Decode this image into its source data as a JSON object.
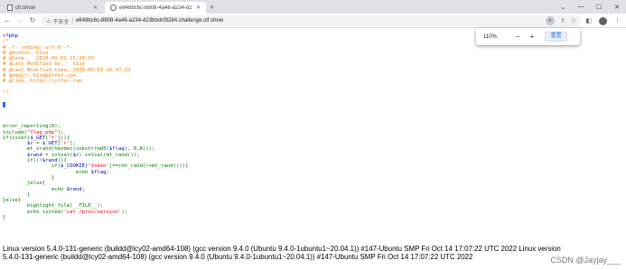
{
  "browser": {
    "tabs": [
      {
        "title": "ctf.show",
        "active": false
      },
      {
        "title": "e648bc6c-8808-4a46-a234-d2",
        "active": true
      }
    ],
    "new_tab": "+",
    "address": {
      "warning": "⚠",
      "insecure_label": "不安全",
      "separator": "|",
      "url": "e648bc6c-8808-4a46-a234-d23bbdcf8284.challenge.ctf.show"
    },
    "zoom_popup": {
      "level": "110%",
      "minus": "−",
      "plus": "+",
      "reset_label": "重置"
    }
  },
  "page": {
    "code": {
      "open_tag": "<?php",
      "header_comment": [
        "/*",
        "# -*- coding: utf-8 -*-",
        "# @Author: h1xa",
        "# @Date:   2020-09-03 15:28:07",
        "# @Last Modified by:   h1xa",
        "# @Last Modified time: 2020-09-03 16:47:33",
        "# @email: h1xa@ctfer.com",
        "# @link: https://ctfer.com",
        "",
        "*/"
      ],
      "body": [
        "",
        "error_reporting(0);",
        "include(\"flag.php\");",
        "if(isset($_GET['r'])){",
        "        $r = $_GET['r'];",
        "        mt_srand(hexdec(substr(md5($flag), 0,8)));",
        "        $rand = intval($r)-intval(mt_rand());",
        "        if((!$rand)){",
        "                if($_COOKIE['token']==(mt_rand()+mt_rand())){",
        "                        echo $flag;",
        "                }",
        "        }else{",
        "                echo $rand;",
        "        }",
        "}else{",
        "        highlight_file(__FILE__);",
        "        echo system('cat /proc/version');",
        "}"
      ]
    },
    "output_lines": [
      "Linux version 5.4.0-131-generic (buildd@lcy02-amd64-108) (gcc version 9.4.0 (Ubuntu 9.4.0-1ubuntu1~20.04.1)) #147-Ubuntu SMP Fri Oct 14 17:07:22 UTC 2022 Linux version",
      "5.4.0-131-generic (buildd@lcy02-amd64-108) (gcc version 9.4.0 (Ubuntu 9.4.0-1ubuntu1~20.04.1)) #147-Ubuntu SMP Fri Oct 14 17:07:22 UTC 2022"
    ],
    "watermark": "CSDN @Jayjay___"
  },
  "colors": {
    "php_tag": "#0000bb",
    "comment": "#ff8000",
    "keyword": "#007700",
    "string": "#dd0000",
    "tabbar": "#dee1e6"
  }
}
